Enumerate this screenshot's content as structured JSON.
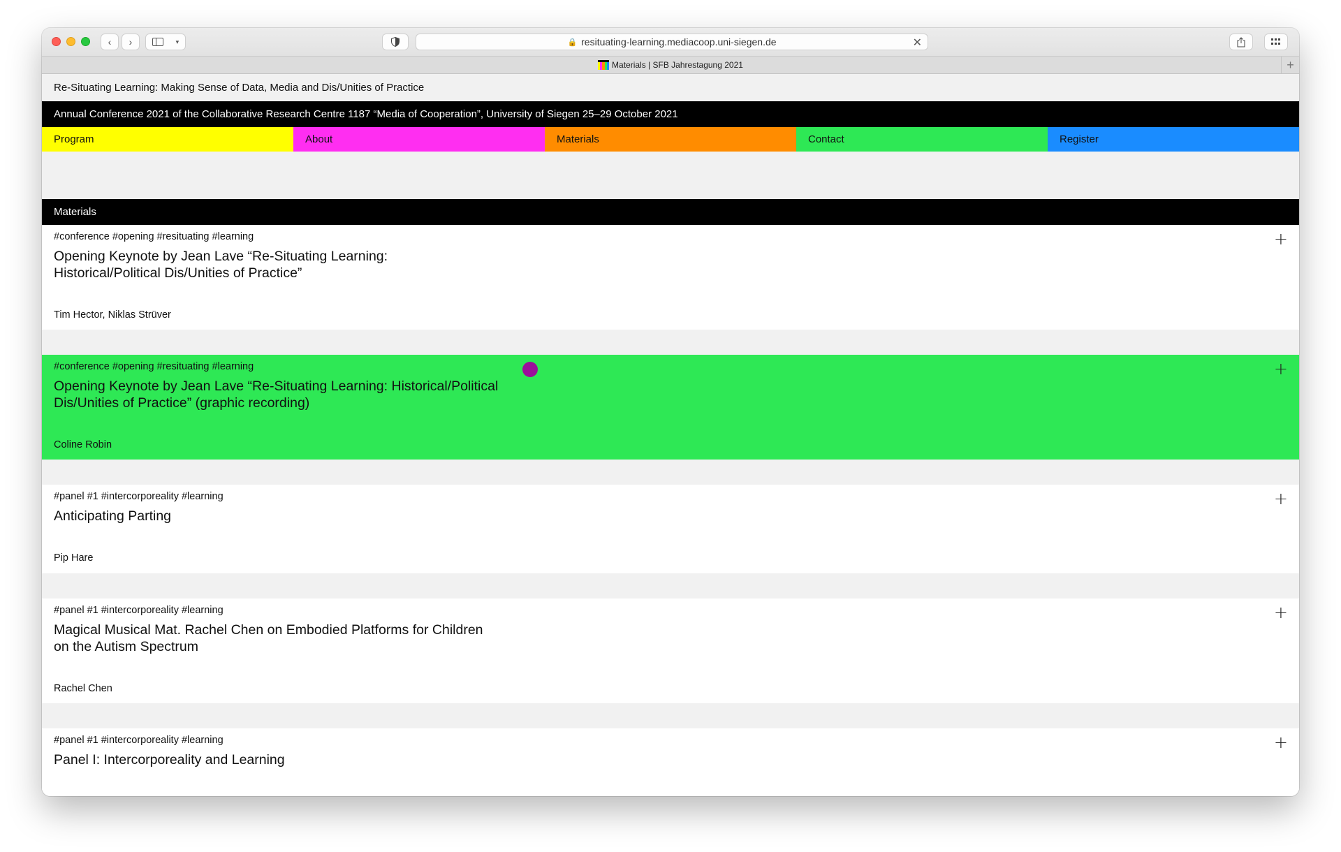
{
  "browser": {
    "url": "resituating-learning.mediacoop.uni-siegen.de",
    "tab_title": "Materials | SFB Jahrestagung 2021"
  },
  "site": {
    "title": "Re-Situating Learning: Making Sense of Data, Media and Dis/Unities of Practice",
    "conference": "Annual Conference 2021 of the Collaborative Research Centre 1187 “Media of Cooperation”, University of Siegen 25–29 October 2021"
  },
  "nav": [
    {
      "label": "Program",
      "color": "#ffff00"
    },
    {
      "label": "About",
      "color": "#ff2ef1"
    },
    {
      "label": "Materials",
      "color": "#ff8c00"
    },
    {
      "label": "Contact",
      "color": "#2ee855"
    },
    {
      "label": "Register",
      "color": "#1a8cff"
    }
  ],
  "section": {
    "heading": "Materials"
  },
  "items": [
    {
      "tags": "#conference #opening #resituating #learning",
      "title": "Opening Keynote by Jean Lave “Re-Situating Learning: Historical/Political Dis/Unities of Practice”",
      "authors": "Tim Hector, Niklas Strüver",
      "expand": "+"
    },
    {
      "tags": "#conference #opening #resituating #learning",
      "title": "Opening Keynote by Jean Lave “Re-Situating Learning: Historical/Political Dis/Unities of Practice” (graphic recording)",
      "authors": "Coline Robin",
      "expand": "+",
      "highlight_color": "#2ee855"
    },
    {
      "tags": "#panel #1 #intercorporeality #learning",
      "title": "Anticipating Parting",
      "authors": "Pip Hare",
      "expand": "+"
    },
    {
      "tags": "#panel #1 #intercorporeality #learning",
      "title": "Magical Musical Mat. Rachel Chen on Embodied Platforms for Children on the Autism Spectrum",
      "authors": "Rachel Chen",
      "expand": "+"
    },
    {
      "tags": "#panel #1 #intercorporeality #learning",
      "title": "Panel I: Intercorporeality and Learning",
      "expand": "+"
    }
  ]
}
